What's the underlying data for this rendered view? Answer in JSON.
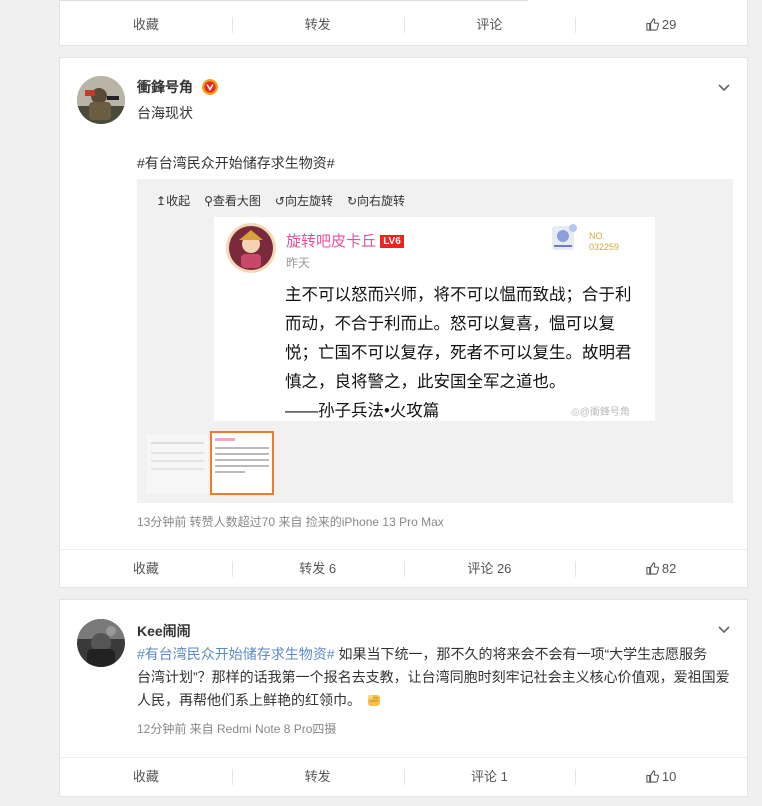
{
  "top_card": {
    "actions": {
      "collect": "收藏",
      "repost": "转发",
      "comment": "评论",
      "like_count": "29"
    }
  },
  "post1": {
    "author": "衝鋒号角",
    "badge_icon": "vip-v-badge",
    "text": "台海现状",
    "hashtag": "#有台湾民众开始储存求生物资#",
    "viewer_toolbar": {
      "collapse": "收起",
      "view_large": "查看大图",
      "rotate_left": "向左旋转",
      "rotate_right": "向右旋转"
    },
    "image": {
      "poster": "旋转吧皮卡丘",
      "level": "LV6",
      "time": "昨天",
      "stamp_label": "NO.",
      "stamp_number": "032259",
      "quote_lines": [
        "主不可以怒而兴师，将不可以愠而致战；合于利",
        "而动，不合于利而止。怒可以复喜，愠可以复",
        "悦；亡国不可以复存，死者不可以复生。故明君",
        "慎之，良将警之，此安国全军之道也。",
        "——孙子兵法•火攻篇"
      ],
      "watermark": "@衝鋒号角"
    },
    "meta": "13分钟前 转赞人数超过70  来自 捡来的iPhone 13 Pro Max",
    "actions": {
      "collect": "收藏",
      "repost": "转发 6",
      "comment": "评论 26",
      "like_count": "82"
    }
  },
  "post2": {
    "author": "Kee闹闹",
    "hashtag": "#有台湾民众开始储存求生物资#",
    "lines": [
      " 如果当下统一，那不久的将来会不会有一项“大学生志愿服务",
      "台湾计划”？那样的话我第一个报名去支教，让台湾同胞时刻牢记社会主义核心价值观，爱祖国爱",
      "人民，再帮他们系上鲜艳的红领巾。"
    ],
    "emoji_icon": "fist-emoji",
    "meta": "12分钟前  来自 Redmi Note 8 Pro四摄",
    "actions": {
      "collect": "收藏",
      "repost": "转发",
      "comment": "评论 1",
      "like_count": "10"
    }
  },
  "colors": {
    "link": "#5c8ac8",
    "pink_name": "#e8509a",
    "orange_selected": "#f07a2e"
  }
}
